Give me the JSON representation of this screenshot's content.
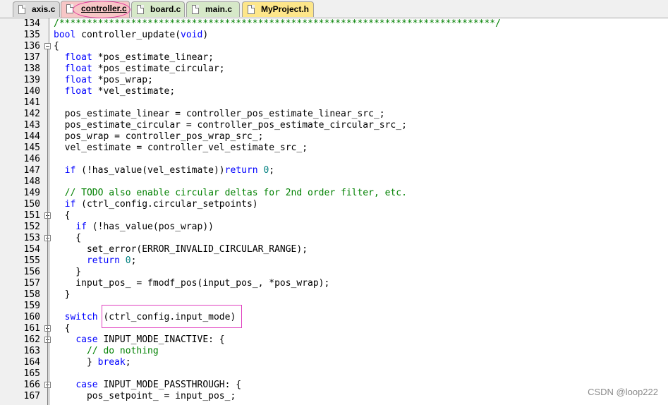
{
  "tabs": [
    {
      "label": "axis.c",
      "color": "#dcdcdc"
    },
    {
      "label": "controller.c",
      "color": "#f7c6c6",
      "active": true
    },
    {
      "label": "board.c",
      "color": "#d6e8c8"
    },
    {
      "label": "main.c",
      "color": "#d6e8c8"
    },
    {
      "label": "MyProject.h",
      "color": "#fde68a"
    }
  ],
  "lines": [
    {
      "n": "134",
      "t": "/*******************************************************************************/",
      "fold": false
    },
    {
      "n": "135",
      "t": "bool controller_update(void)",
      "fold": false
    },
    {
      "n": "136",
      "t": "{",
      "fold": true
    },
    {
      "n": "137",
      "t": "  float *pos_estimate_linear;",
      "fold": false
    },
    {
      "n": "138",
      "t": "  float *pos_estimate_circular;",
      "fold": false
    },
    {
      "n": "139",
      "t": "  float *pos_wrap;",
      "fold": false
    },
    {
      "n": "140",
      "t": "  float *vel_estimate;",
      "fold": false
    },
    {
      "n": "141",
      "t": "",
      "fold": false
    },
    {
      "n": "142",
      "t": "  pos_estimate_linear = controller_pos_estimate_linear_src_;",
      "fold": false
    },
    {
      "n": "143",
      "t": "  pos_estimate_circular = controller_pos_estimate_circular_src_;",
      "fold": false
    },
    {
      "n": "144",
      "t": "  pos_wrap = controller_pos_wrap_src_;",
      "fold": false
    },
    {
      "n": "145",
      "t": "  vel_estimate = controller_vel_estimate_src_;",
      "fold": false
    },
    {
      "n": "146",
      "t": "",
      "fold": false
    },
    {
      "n": "147",
      "t": "  if (!has_value(vel_estimate))return 0;",
      "fold": false
    },
    {
      "n": "148",
      "t": "",
      "fold": false
    },
    {
      "n": "149",
      "t": "  // TODO also enable circular deltas for 2nd order filter, etc.",
      "fold": false
    },
    {
      "n": "150",
      "t": "  if (ctrl_config.circular_setpoints)",
      "fold": false
    },
    {
      "n": "151",
      "t": "  {",
      "fold": true
    },
    {
      "n": "152",
      "t": "    if (!has_value(pos_wrap))",
      "fold": false
    },
    {
      "n": "153",
      "t": "    {",
      "fold": true
    },
    {
      "n": "154",
      "t": "      set_error(ERROR_INVALID_CIRCULAR_RANGE);",
      "fold": false
    },
    {
      "n": "155",
      "t": "      return 0;",
      "fold": false
    },
    {
      "n": "156",
      "t": "    }",
      "fold": false
    },
    {
      "n": "157",
      "t": "    input_pos_ = fmodf_pos(input_pos_, *pos_wrap);",
      "fold": false
    },
    {
      "n": "158",
      "t": "  }",
      "fold": false
    },
    {
      "n": "159",
      "t": "",
      "fold": false
    },
    {
      "n": "160",
      "t": "  switch (ctrl_config.input_mode)",
      "fold": false
    },
    {
      "n": "161",
      "t": "  {",
      "fold": true
    },
    {
      "n": "162",
      "t": "    case INPUT_MODE_INACTIVE: {",
      "fold": true
    },
    {
      "n": "163",
      "t": "      // do nothing",
      "fold": false
    },
    {
      "n": "164",
      "t": "      } break;",
      "fold": false
    },
    {
      "n": "165",
      "t": "",
      "fold": false
    },
    {
      "n": "166",
      "t": "    case INPUT_MODE_PASSTHROUGH: {",
      "fold": true
    },
    {
      "n": "167",
      "t": "      pos_setpoint_ = input_pos_;",
      "fold": false
    }
  ],
  "watermark": "CSDN @loop222",
  "colors": {
    "keyword": "#0000ff",
    "comment": "#008000",
    "number": "#008080",
    "highlight": "#e040c0"
  }
}
